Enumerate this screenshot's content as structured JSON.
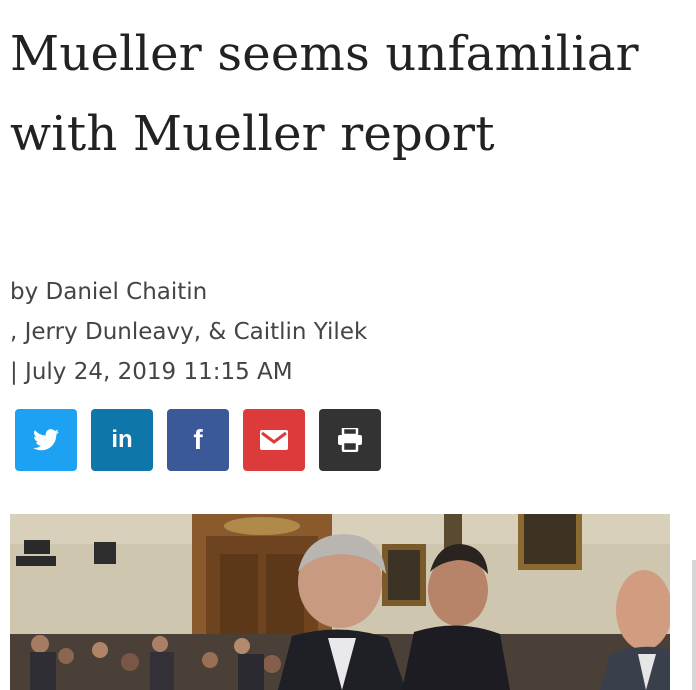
{
  "article": {
    "headline": "Mueller seems unfamiliar with Mueller report",
    "byline": {
      "line1": "by Daniel Chaitin",
      "line2": ", Jerry Dunleavy, & Caitlin Yilek",
      "line3": "| July 24, 2019 11:15 AM"
    }
  },
  "share_buttons": [
    {
      "name": "twitter",
      "icon": "twitter-icon",
      "color": "#1da1f2"
    },
    {
      "name": "linkedin",
      "icon": "linkedin-icon",
      "color": "#0e76a8",
      "label": "in"
    },
    {
      "name": "facebook",
      "icon": "facebook-icon",
      "color": "#3b5998",
      "label": "f"
    },
    {
      "name": "email",
      "icon": "envelope-icon",
      "color": "#dd3b3b"
    },
    {
      "name": "print",
      "icon": "printer-icon",
      "color": "#333333"
    }
  ],
  "photo": {
    "wall_color": "#cfc6b0",
    "description_icon": "hearing-photo"
  }
}
